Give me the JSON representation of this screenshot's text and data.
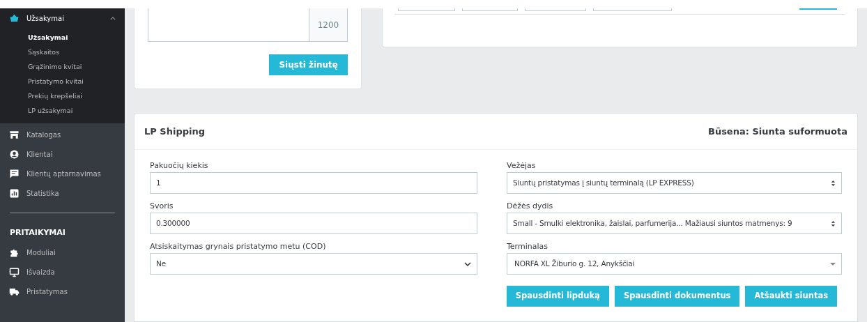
{
  "sidebar": {
    "groups": [
      {
        "kind": "menu",
        "items": [
          {
            "label": "Užsakymai",
            "expanded": true,
            "children": [
              {
                "label": "Užsakymai",
                "selected": true
              },
              {
                "label": "Sąskaitos",
                "selected": false
              },
              {
                "label": "Grąžinimo kvitai",
                "selected": false
              },
              {
                "label": "Pristatymo kvitai",
                "selected": false
              },
              {
                "label": "Prekių krepšeliai",
                "selected": false
              },
              {
                "label": "LP užsakymai",
                "selected": false
              }
            ]
          },
          {
            "label": "Katalogas",
            "expanded": false
          },
          {
            "label": "Klientai",
            "expanded": false
          },
          {
            "label": "Klientų aptarnavimas",
            "expanded": false
          },
          {
            "label": "Statistika",
            "expanded": false
          }
        ]
      },
      {
        "kind": "section",
        "title": "PRITAIKYMAI",
        "items": [
          {
            "label": "Moduliai",
            "expanded": false
          },
          {
            "label": "Išvaizda",
            "expanded": false
          },
          {
            "label": "Pristatymas",
            "expanded": false
          }
        ]
      }
    ]
  },
  "message_card": {
    "counter": "1200",
    "send_button": "Siųsti žinutę"
  },
  "shipping": {
    "title": "LP Shipping",
    "status": "Būsena: Siunta suformuota",
    "left_fields": [
      {
        "label": "Pakuočių kiekis",
        "kind": "input",
        "value": "1"
      },
      {
        "label": "Svoris",
        "kind": "input",
        "value": "0.300000"
      },
      {
        "label": "Atsiskaitymas grynais pristatymo metu (COD)",
        "kind": "select",
        "value": "Ne"
      }
    ],
    "right_fields": [
      {
        "label": "Vežėjas",
        "kind": "updown",
        "value": "Siuntų pristatymas į siuntų terminalą (LP EXPRESS)"
      },
      {
        "label": "Dėžės dydis",
        "kind": "updown",
        "value": "Small - Smulki elektronika, žaislai, parfumerija... Mažiausi siuntos matmenys: 9"
      },
      {
        "label": "Terminalas",
        "kind": "combo",
        "value": "NORFA XL Žiburio g. 12, Anykščiai"
      }
    ],
    "buttons": [
      "Spausdinti lipduką",
      "Spausdinti dokumentus",
      "Atšaukti siuntas"
    ]
  }
}
